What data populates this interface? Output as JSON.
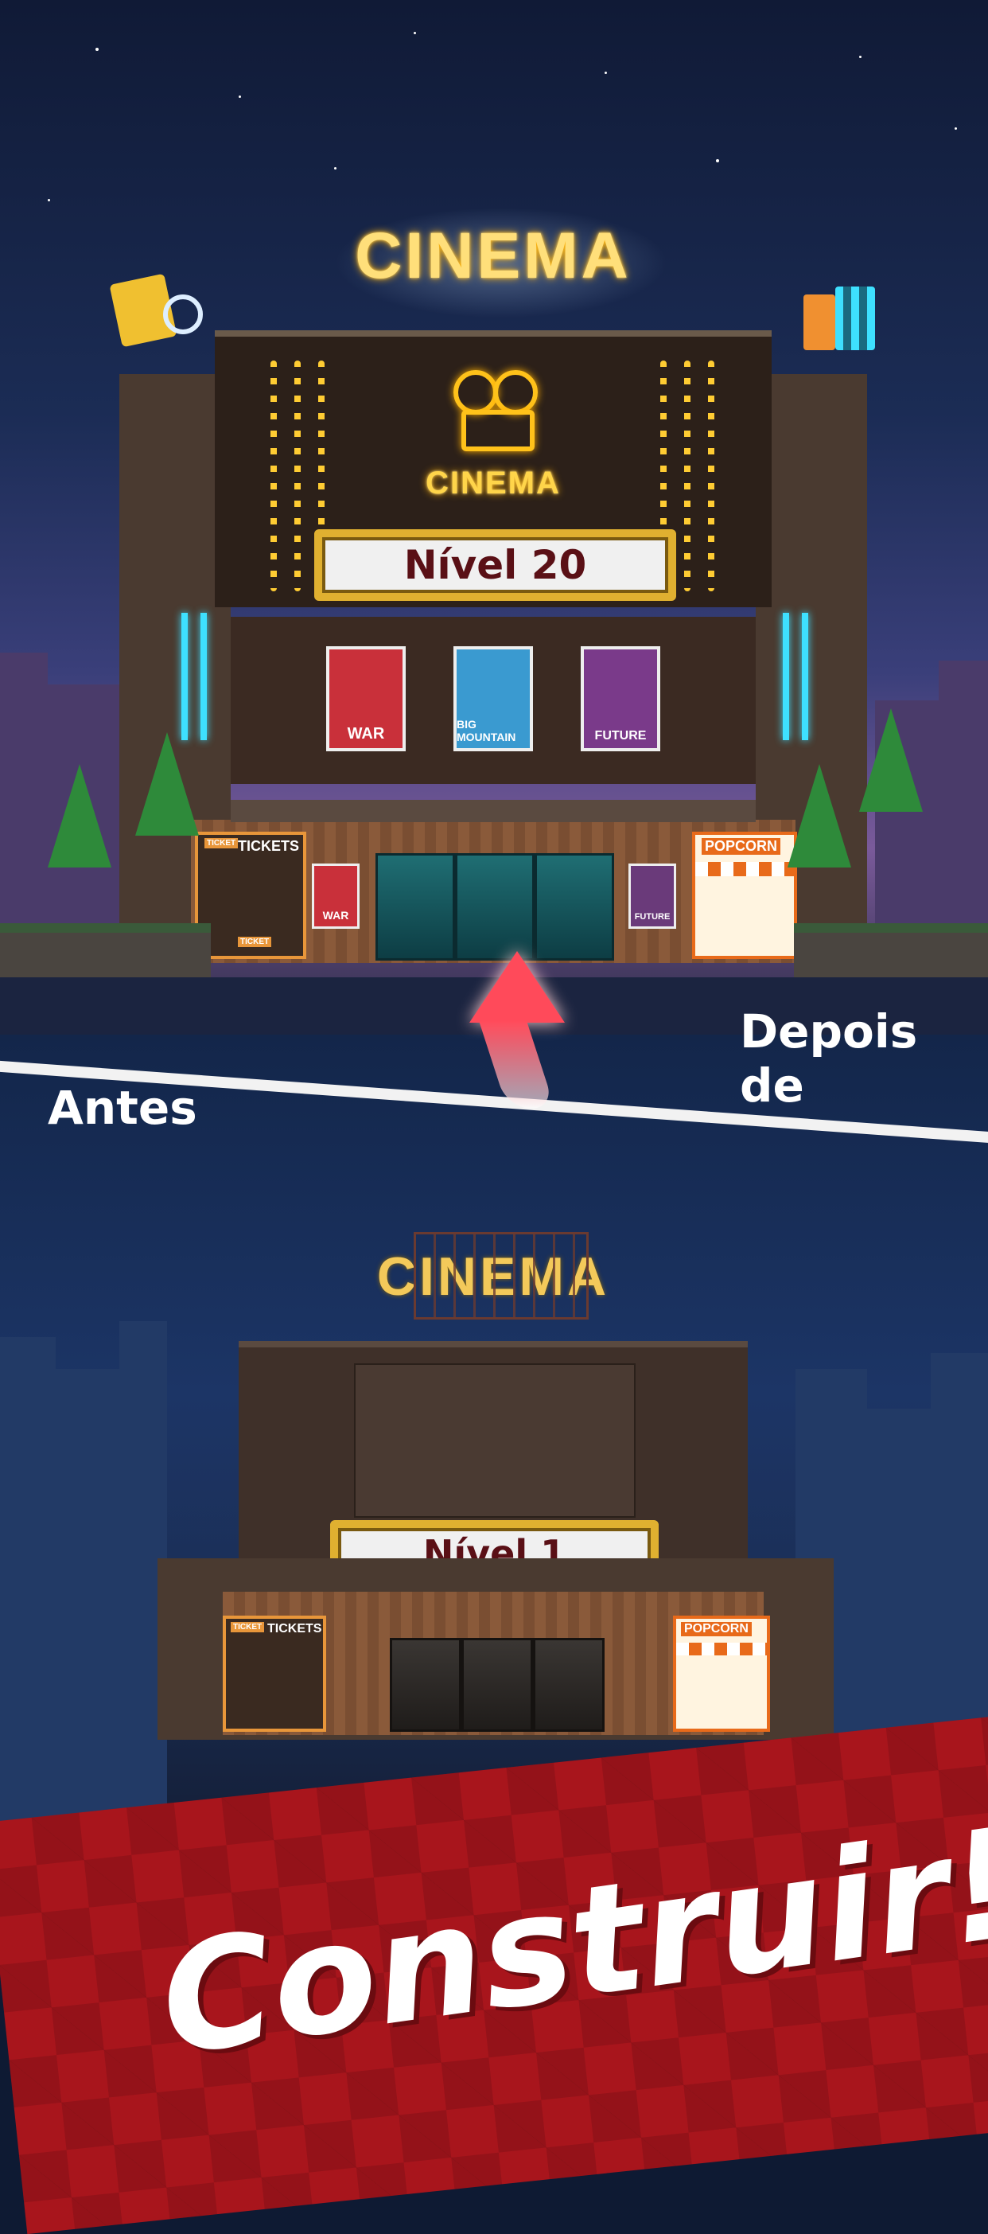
{
  "top_scene": {
    "marquee": "CINEMA",
    "neon_sign": "CINEMA",
    "level_label": "Nível 20",
    "posters": [
      {
        "title": "WAR",
        "color": "#c9303a"
      },
      {
        "title": "BIG MOUNTAIN",
        "color": "#3a9ad0"
      },
      {
        "title": "FUTURE",
        "color": "#7a3a8a"
      }
    ],
    "small_posters": [
      {
        "title": "WAR",
        "color": "#c9303a"
      },
      {
        "title": "FUTURE",
        "color": "#6a3a7a"
      }
    ],
    "ticket_booth": "TICKETS",
    "ticket_sign": "TICKET",
    "ticket_window": "TICKET",
    "popcorn_booth": "POPCORN"
  },
  "captions": {
    "after": "Depois de",
    "before": "Antes"
  },
  "bottom_scene": {
    "marquee": "CINEMA",
    "level_label": "Nível 1",
    "ticket_booth": "TICKETS",
    "ticket_sign": "TICKET",
    "popcorn_booth": "POPCORN"
  },
  "banner": {
    "text": "Construir!",
    "color": "#a8151c"
  },
  "icons": [
    "clapperboard-icon",
    "megaphone-icon",
    "soda-cup-icon",
    "popcorn-icon",
    "film-camera-icon",
    "up-arrow-icon"
  ]
}
